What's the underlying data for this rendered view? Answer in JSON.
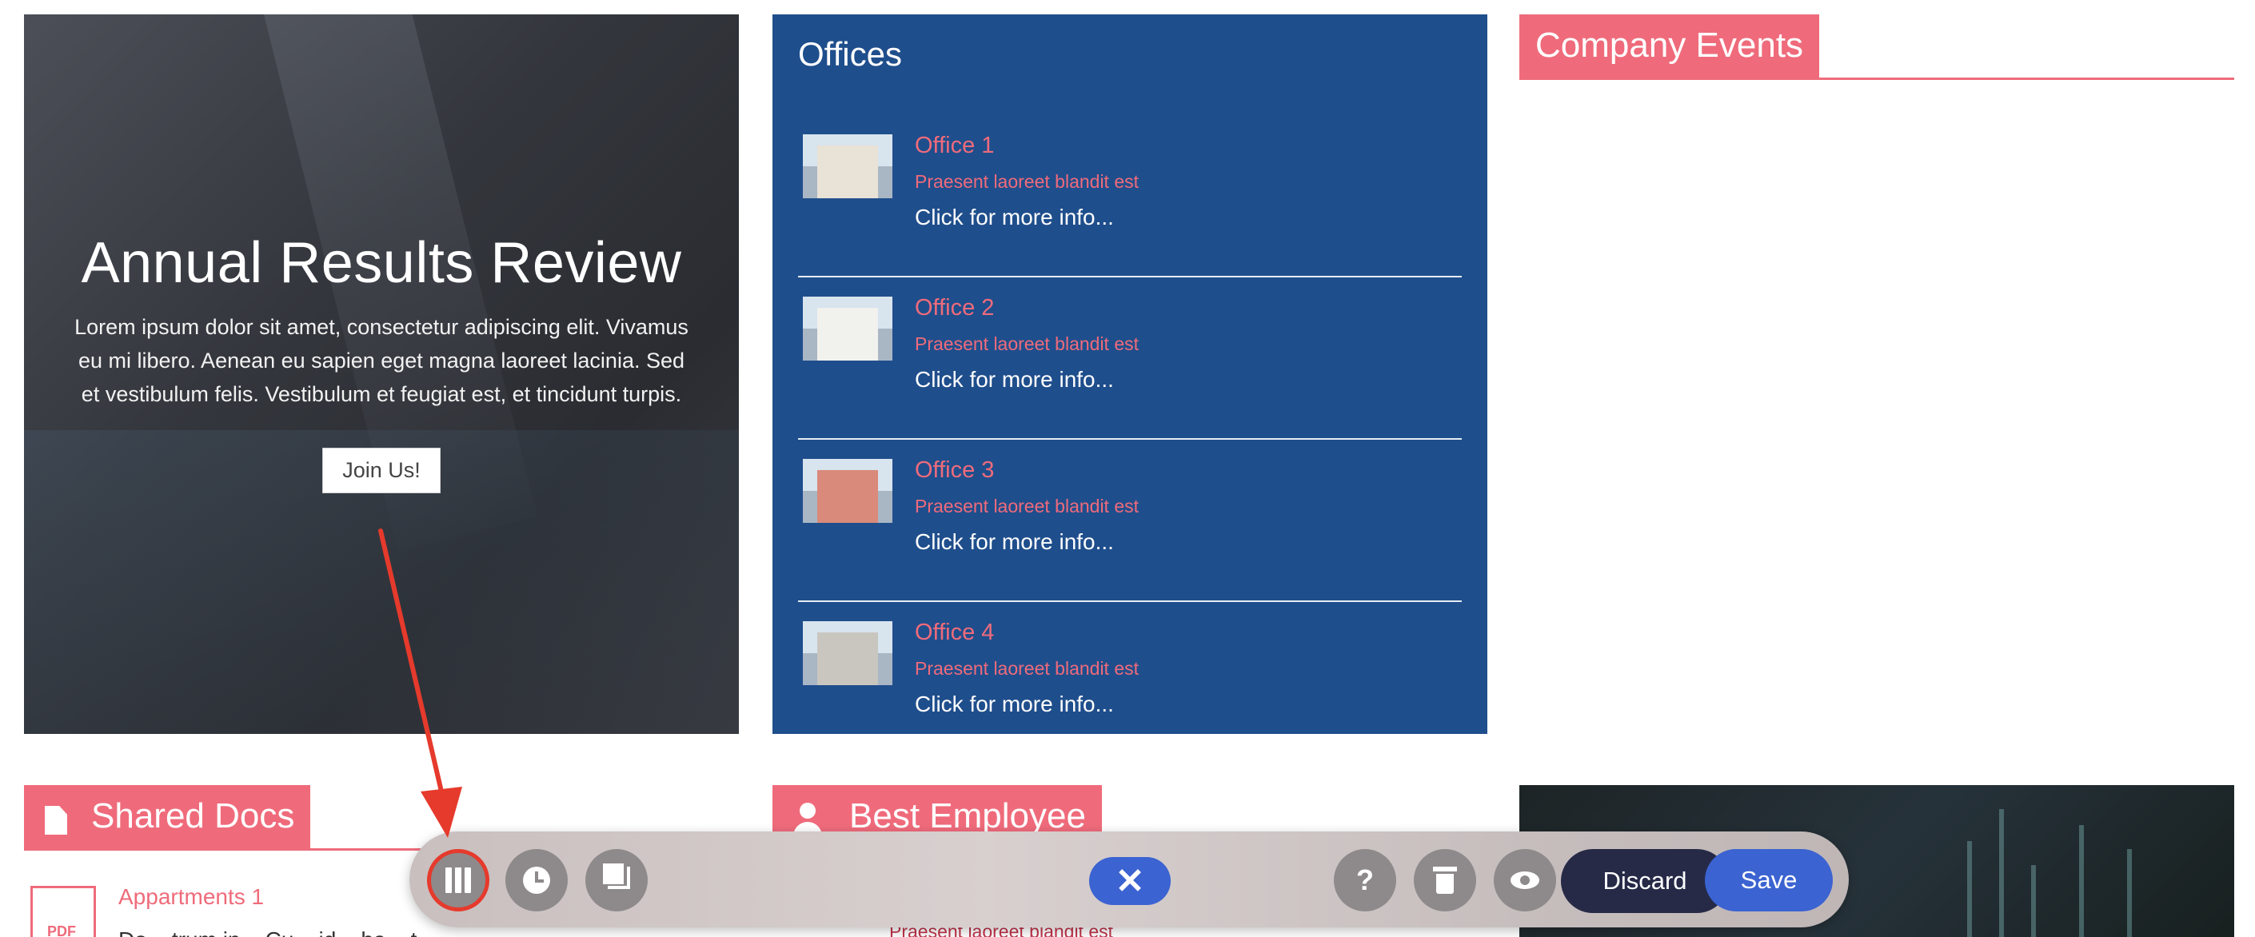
{
  "hero": {
    "title": "Annual Results Review",
    "text": "Lorem ipsum dolor sit amet, consectetur adipiscing elit. Vivamus eu mi libero. Aenean eu sapien eget magna laoreet lacinia. Sed et vestibulum felis. Vestibulum et feugiat est, et tincidunt turpis.",
    "button_label": "Join Us!"
  },
  "offices": {
    "title": "Offices",
    "items": [
      {
        "name": "Office 1",
        "subtitle": "Praesent laoreet blandit est",
        "more": "Click for more info..."
      },
      {
        "name": "Office 2",
        "subtitle": "Praesent laoreet blandit est",
        "more": "Click for more info..."
      },
      {
        "name": "Office 3",
        "subtitle": "Praesent laoreet blandit est",
        "more": "Click for more info..."
      },
      {
        "name": "Office 4",
        "subtitle": "Praesent laoreet blandit est",
        "more": "Click for more info..."
      }
    ]
  },
  "events": {
    "title": "Company Events"
  },
  "docs": {
    "title": "Shared Docs",
    "items": [
      {
        "icon_label": "PDF",
        "name": "Appartments 1",
        "desc": "Do... trum in... Cu... id... ha... t"
      }
    ]
  },
  "best_employee": {
    "title": "Best Employee",
    "subtitle": "Praesent laoreet blandit est"
  },
  "toolbar": {
    "close_symbol": "✕",
    "help_symbol": "?",
    "discard_label": "Discard",
    "save_label": "Save"
  },
  "colors": {
    "accent": "#ef6b7b",
    "offices_bg": "#1f4e8c",
    "primary_button": "#3b63d1",
    "discard_button": "#262a47",
    "annotation": "#e53a2c"
  },
  "icons": [
    "layout-columns-icon",
    "history-clock-icon",
    "copy-icon",
    "close-icon",
    "help-icon",
    "trash-icon",
    "eye-icon",
    "document-icon",
    "person-icon"
  ]
}
